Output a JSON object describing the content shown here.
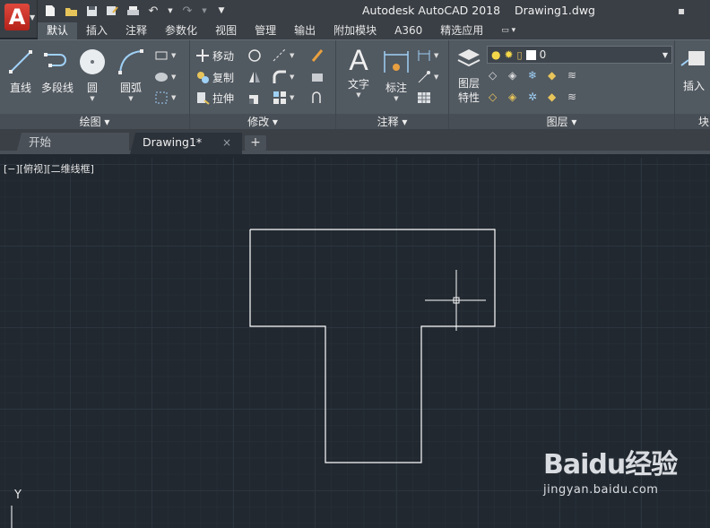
{
  "app": {
    "logo_letter": "A",
    "title": "Autodesk AutoCAD 2018    Drawing1.dwg"
  },
  "quick_access": {
    "icons": [
      "new-icon",
      "open-icon",
      "save-icon",
      "save-as-icon",
      "print-icon",
      "undo-icon",
      "redo-icon",
      "customize-icon"
    ]
  },
  "ribbon_tabs": [
    "默认",
    "插入",
    "注释",
    "参数化",
    "视图",
    "管理",
    "输出",
    "附加模块",
    "A360",
    "精选应用"
  ],
  "panels": {
    "draw": {
      "title": "绘图",
      "tools": [
        "直线",
        "多段线",
        "圆",
        "圆弧"
      ]
    },
    "modify": {
      "title": "修改",
      "tools": [
        "移动",
        "复制",
        "拉伸"
      ]
    },
    "annotation": {
      "title": "注释",
      "tools": [
        "文字",
        "标注"
      ]
    },
    "layers": {
      "title": "图层",
      "tools": [
        "图层\n特性"
      ],
      "current_layer": "0"
    },
    "block": {
      "title": "块",
      "tools": [
        "插入"
      ]
    }
  },
  "file_tabs": {
    "start": "开始",
    "drawing": "Drawing1*",
    "close": "×",
    "new_tab": "+"
  },
  "viewport": {
    "label": "[−][俯视][二维线框]",
    "ucs_axis": "Y"
  },
  "watermark": {
    "logo": "Baidu经验",
    "url": "jingyan.baidu.com"
  },
  "colors": {
    "canvas": "#212830",
    "ribbon": "#515961",
    "app_red": "#c8322a"
  }
}
